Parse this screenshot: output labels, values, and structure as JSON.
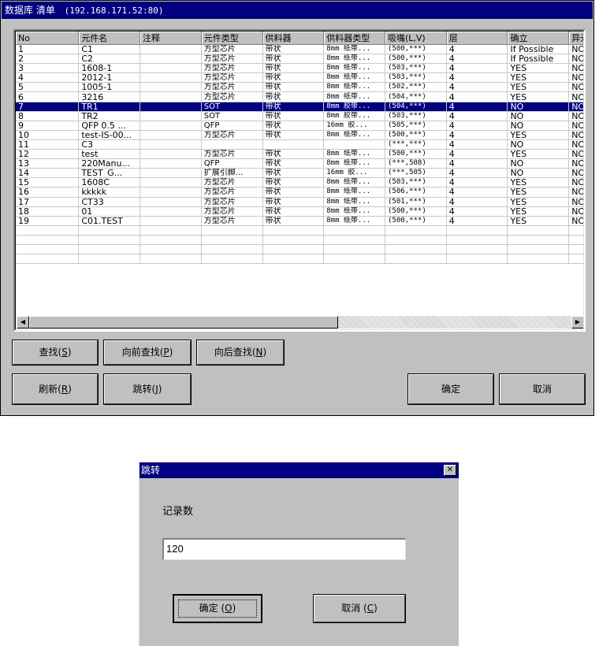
{
  "main_window": {
    "title": "数据库 清单",
    "address": "(192.168.171.52:80)",
    "columns": [
      "No",
      "元件名",
      "注释",
      "元件类型",
      "供料器",
      "供料器类型",
      "吸嘴(L,V)",
      "层",
      "确立",
      "异元件"
    ],
    "rows": [
      {
        "no": "1",
        "name": "C1",
        "comment": "",
        "type": "方型芯片",
        "feeder": "带状",
        "feeder_type": "8mm 纸带...",
        "nozzle": "(500,***)",
        "layer": "4",
        "confirm": "If Possible",
        "alt": "NO"
      },
      {
        "no": "2",
        "name": "C2",
        "comment": "",
        "type": "方型芯片",
        "feeder": "带状",
        "feeder_type": "8mm 纸带...",
        "nozzle": "(500,***)",
        "layer": "4",
        "confirm": "If Possible",
        "alt": "NO"
      },
      {
        "no": "3",
        "name": "1608-1",
        "comment": "",
        "type": "方型芯片",
        "feeder": "带状",
        "feeder_type": "8mm 纸带...",
        "nozzle": "(503,***)",
        "layer": "4",
        "confirm": "YES",
        "alt": "NO"
      },
      {
        "no": "4",
        "name": "2012-1",
        "comment": "",
        "type": "方型芯片",
        "feeder": "带状",
        "feeder_type": "8mm 纸带...",
        "nozzle": "(503,***)",
        "layer": "4",
        "confirm": "YES",
        "alt": "NO"
      },
      {
        "no": "5",
        "name": "1005-1",
        "comment": "",
        "type": "方型芯片",
        "feeder": "带状",
        "feeder_type": "8mm 纸带...",
        "nozzle": "(502,***)",
        "layer": "4",
        "confirm": "YES",
        "alt": "NO"
      },
      {
        "no": "6",
        "name": "3216",
        "comment": "",
        "type": "方型芯片",
        "feeder": "带状",
        "feeder_type": "8mm 纸带...",
        "nozzle": "(504,***)",
        "layer": "4",
        "confirm": "YES",
        "alt": "NO"
      },
      {
        "no": "7",
        "name": "TR1",
        "comment": "",
        "type": "SOT",
        "feeder": "带状",
        "feeder_type": "8mm 胶带...",
        "nozzle": "(504,***)",
        "layer": "4",
        "confirm": "NO",
        "alt": "NO"
      },
      {
        "no": "8",
        "name": "TR2",
        "comment": "",
        "type": "SOT",
        "feeder": "带状",
        "feeder_type": "8mm 胶带...",
        "nozzle": "(503,***)",
        "layer": "4",
        "confirm": "NO",
        "alt": "NO"
      },
      {
        "no": "9",
        "name": "QFP 0.5 ...",
        "comment": "",
        "type": "QFP",
        "feeder": "带状",
        "feeder_type": "16mm 胶...",
        "nozzle": "(505,***)",
        "layer": "4",
        "confirm": "NO",
        "alt": "NO"
      },
      {
        "no": "10",
        "name": "test-IS-00...",
        "comment": "",
        "type": "方型芯片",
        "feeder": "带状",
        "feeder_type": "8mm 纸带...",
        "nozzle": "(500,***)",
        "layer": "4",
        "confirm": "YES",
        "alt": "NO"
      },
      {
        "no": "11",
        "name": "C3",
        "comment": "",
        "type": "",
        "feeder": "",
        "feeder_type": "",
        "nozzle": "(***,***)",
        "layer": "4",
        "confirm": "NO",
        "alt": "NO"
      },
      {
        "no": "12",
        "name": "test",
        "comment": "",
        "type": "方型芯片",
        "feeder": "带状",
        "feeder_type": "8mm 纸带...",
        "nozzle": "(500,***)",
        "layer": "4",
        "confirm": "YES",
        "alt": "NO"
      },
      {
        "no": "13",
        "name": "220Manu...",
        "comment": "",
        "type": "QFP",
        "feeder": "带状",
        "feeder_type": "8mm 纸带...",
        "nozzle": "(***,508)",
        "layer": "4",
        "confirm": "NO",
        "alt": "NO"
      },
      {
        "no": "14",
        "name": "TEST_G...",
        "comment": "",
        "type": "扩展引脚...",
        "feeder": "带状",
        "feeder_type": "16mm 胶...",
        "nozzle": "(***,505)",
        "layer": "4",
        "confirm": "NO",
        "alt": "NO"
      },
      {
        "no": "15",
        "name": "1608C",
        "comment": "",
        "type": "方型芯片",
        "feeder": "带状",
        "feeder_type": "8mm 纸带...",
        "nozzle": "(503,***)",
        "layer": "4",
        "confirm": "YES",
        "alt": "NO"
      },
      {
        "no": "16",
        "name": "kkkkk",
        "comment": "",
        "type": "方型芯片",
        "feeder": "带状",
        "feeder_type": "8mm 纸带...",
        "nozzle": "(506,***)",
        "layer": "4",
        "confirm": "YES",
        "alt": "NO"
      },
      {
        "no": "17",
        "name": "CT33",
        "comment": "",
        "type": "方型芯片",
        "feeder": "带状",
        "feeder_type": "8mm 纸带...",
        "nozzle": "(501,***)",
        "layer": "4",
        "confirm": "YES",
        "alt": "NO"
      },
      {
        "no": "18",
        "name": "01",
        "comment": "",
        "type": "方型芯片",
        "feeder": "带状",
        "feeder_type": "8mm 纸带...",
        "nozzle": "(500,***)",
        "layer": "4",
        "confirm": "YES",
        "alt": "NO"
      },
      {
        "no": "19",
        "name": "C01.TEST",
        "comment": "",
        "type": "方型芯片",
        "feeder": "带状",
        "feeder_type": "8mm 纸带...",
        "nozzle": "(500,***)",
        "layer": "4",
        "confirm": "YES",
        "alt": "NO"
      }
    ],
    "selected_row": "7",
    "buttons": {
      "find": {
        "text": "查找(",
        "key": "S",
        "end": ")"
      },
      "find_prev": {
        "text": "向前查找(",
        "key": "P",
        "end": ")"
      },
      "find_next": {
        "text": "向后查找(",
        "key": "N",
        "end": ")"
      },
      "refresh": {
        "text": "刷新(",
        "key": "R",
        "end": ")"
      },
      "jump": {
        "text": "跳转(",
        "key": "J",
        "end": ")"
      },
      "ok": "确定",
      "cancel": "取消"
    }
  },
  "jump_dialog": {
    "title": "跳转",
    "close_glyph": "✕",
    "label": "记录数",
    "value": "120",
    "ok": {
      "text": "确定 (",
      "key": "O",
      "end": ")"
    },
    "cancel": {
      "text": "取消 (",
      "key": "C",
      "end": ")"
    }
  },
  "colors": {
    "face": "#c0c0c0",
    "title": "#000080",
    "selection": "#000080"
  }
}
